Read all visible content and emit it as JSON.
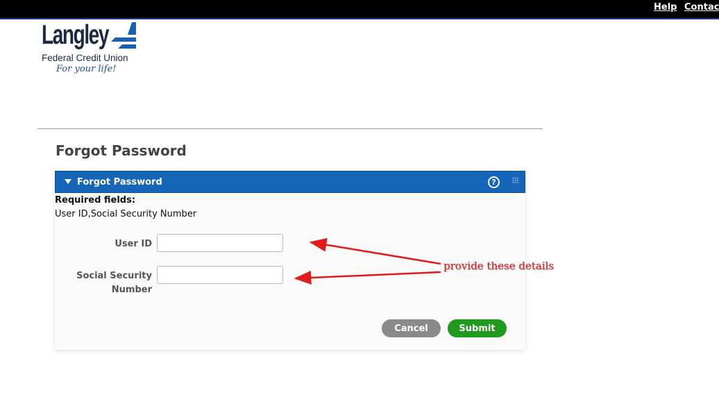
{
  "header": {
    "links": [
      "Help",
      "Contact"
    ]
  },
  "logo": {
    "name": "Langley",
    "subtitle": "Federal Credit Union",
    "tagline": "For your life!"
  },
  "page": {
    "title": "Forgot Password"
  },
  "panel": {
    "title": "Forgot Password",
    "required_title": "Required fields:",
    "required_list": "User ID,Social Security Number",
    "fields": [
      {
        "label": "User ID",
        "value": "",
        "placeholder": ""
      },
      {
        "label_line1": "Social Security",
        "label_line2": "Number",
        "value": "",
        "placeholder": ""
      }
    ],
    "buttons": {
      "cancel": "Cancel",
      "submit": "Submit"
    }
  },
  "annotation": {
    "text": "provide these details",
    "color": "#e01b1b"
  },
  "colors": {
    "header_bar": "#000000",
    "panel_header": "#1565b8",
    "submit": "#1f9a1f",
    "cancel": "#8a8a8a"
  }
}
